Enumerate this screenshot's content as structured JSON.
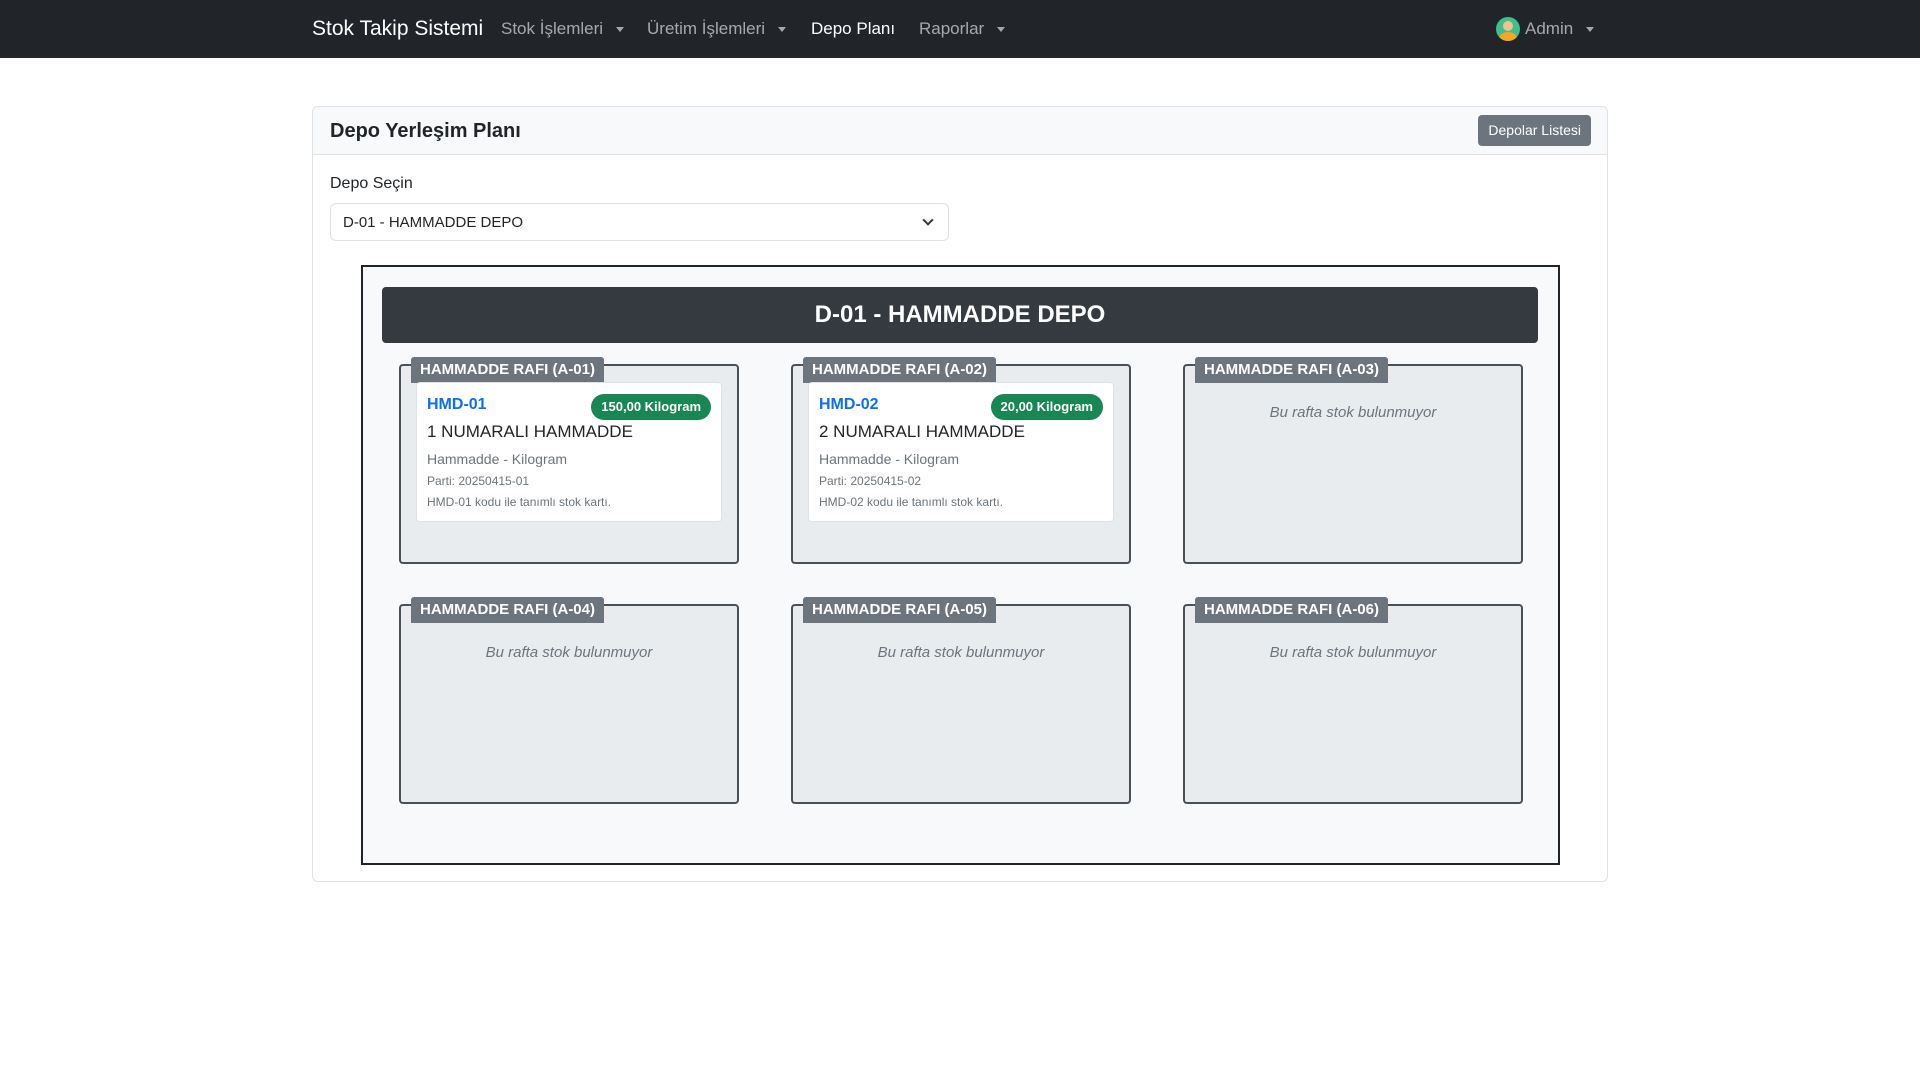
{
  "navbar": {
    "brand": "Stok Takip Sistemi",
    "items": [
      {
        "label": "Stok İşlemleri",
        "dropdown": true,
        "active": false
      },
      {
        "label": "Üretim İşlemleri",
        "dropdown": true,
        "active": false
      },
      {
        "label": "Depo Planı",
        "dropdown": false,
        "active": true
      },
      {
        "label": "Raporlar",
        "dropdown": true,
        "active": false
      }
    ],
    "user": {
      "name": "Admin",
      "icon": "user-avatar-icon"
    }
  },
  "card": {
    "title": "Depo Yerleşim Planı",
    "list_button_label": "Depolar Listesi"
  },
  "form": {
    "label": "Depo Seçin",
    "selected_value": "D-01 - HAMMADDE DEPO"
  },
  "map": {
    "title": "D-01 - HAMMADDE DEPO",
    "empty_text": "Bu rafta stok bulunmuyor",
    "shelves": [
      {
        "label": "HAMMADDE RAFI (A-01)",
        "stock": {
          "code": "HMD-01",
          "quantity": "150,00 Kilogram",
          "name": "1 NUMARALI HAMMADDE",
          "type": "Hammadde - Kilogram",
          "batch": "Parti: 20250415-01",
          "description": "HMD-01 kodu ile tanımlı stok kartı."
        }
      },
      {
        "label": "HAMMADDE RAFI (A-02)",
        "stock": {
          "code": "HMD-02",
          "quantity": "20,00 Kilogram",
          "name": "2 NUMARALI HAMMADDE",
          "type": "Hammadde - Kilogram",
          "batch": "Parti: 20250415-02",
          "description": "HMD-02 kodu ile tanımlı stok kartı."
        }
      },
      {
        "label": "HAMMADDE RAFI (A-03)"
      },
      {
        "label": "HAMMADDE RAFI (A-04)"
      },
      {
        "label": "HAMMADDE RAFI (A-05)"
      },
      {
        "label": "HAMMADDE RAFI (A-06)"
      }
    ]
  },
  "colors": {
    "navbar_bg": "#212529",
    "map_header_bg": "#343a40",
    "shelf_label_bg": "#6c757d",
    "badge_green": "#198754",
    "code_blue": "#0d6efd"
  }
}
